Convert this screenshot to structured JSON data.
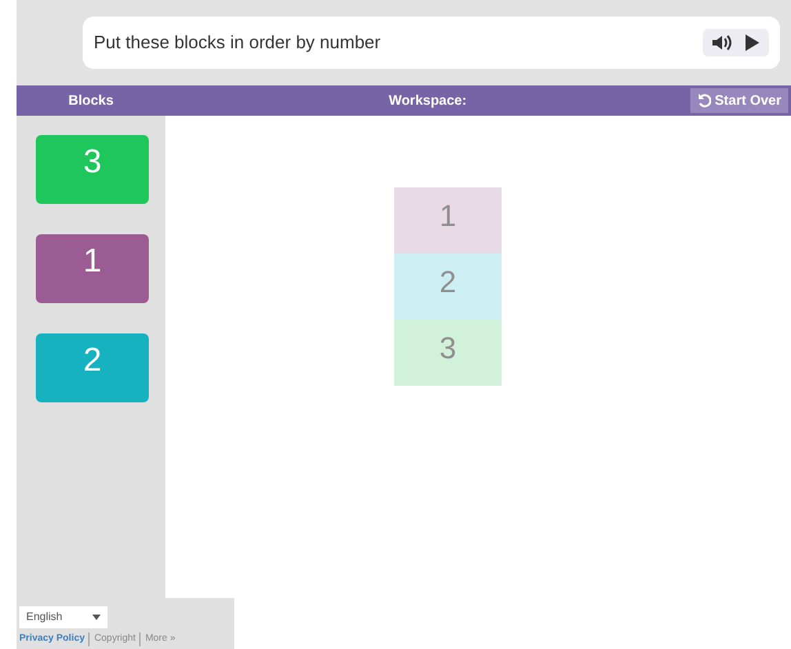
{
  "prompt": {
    "text": "Put these blocks in order by number"
  },
  "header": {
    "blocks_label": "Blocks",
    "workspace_label": "Workspace:",
    "start_over": "Start Over"
  },
  "palette": [
    {
      "label": "3",
      "color": "#1fc65c"
    },
    {
      "label": "1",
      "color": "#9a5c93"
    },
    {
      "label": "2",
      "color": "#17b2bf"
    }
  ],
  "workspace": [
    {
      "label": "1",
      "color": "#e8dbe6"
    },
    {
      "label": "2",
      "color": "#cdeef2"
    },
    {
      "label": "3",
      "color": "#d2f1da"
    }
  ],
  "footer": {
    "language": "English",
    "links": [
      {
        "text": "Privacy Policy",
        "kind": "link"
      },
      {
        "text": "Copyright",
        "kind": "plain"
      },
      {
        "text": "More »",
        "kind": "plain"
      }
    ]
  }
}
